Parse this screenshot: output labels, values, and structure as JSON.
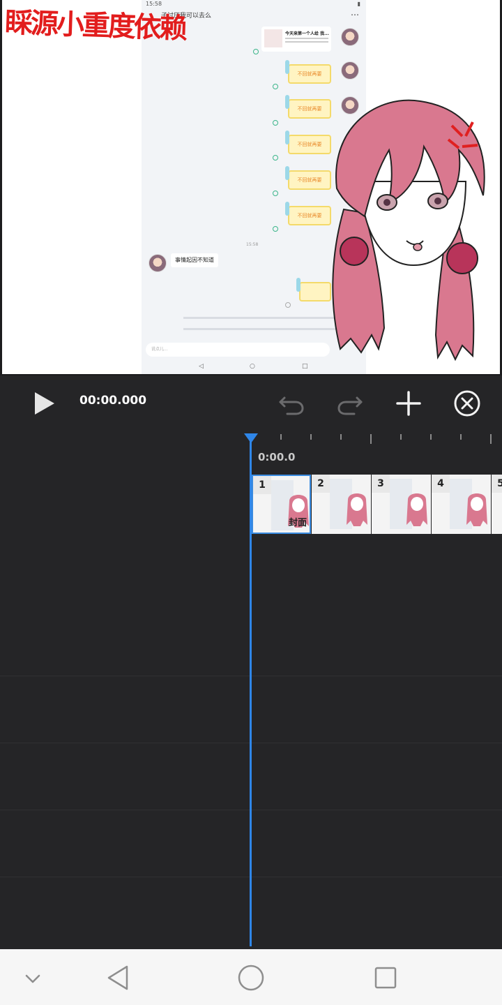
{
  "preview": {
    "watermark_text": "睬源小重度依赖",
    "phone": {
      "status_time": "15:58",
      "chat_title": "子讨厌我可以去么",
      "more_icon": "more-icon",
      "card_title": "今天来第一个人给 我...",
      "sticker_text": "不回就再要",
      "time_label": "15:58",
      "left_message": "事情起因不知道",
      "input_placeholder": "说点儿..."
    }
  },
  "toolbar": {
    "timecode": "00:00.000",
    "icons": [
      "play-icon",
      "undo-icon",
      "redo-icon",
      "add-icon",
      "close-circle-icon"
    ]
  },
  "timeline": {
    "ruler_time": "0:00.0",
    "frames": [
      {
        "num": "1",
        "label": "封面"
      },
      {
        "num": "2"
      },
      {
        "num": "3"
      },
      {
        "num": "4"
      },
      {
        "num": "5"
      }
    ],
    "accent_color": "#2f86e8"
  },
  "system_nav": {
    "icons": [
      "collapse-icon",
      "back-icon",
      "home-icon",
      "recents-icon"
    ]
  }
}
